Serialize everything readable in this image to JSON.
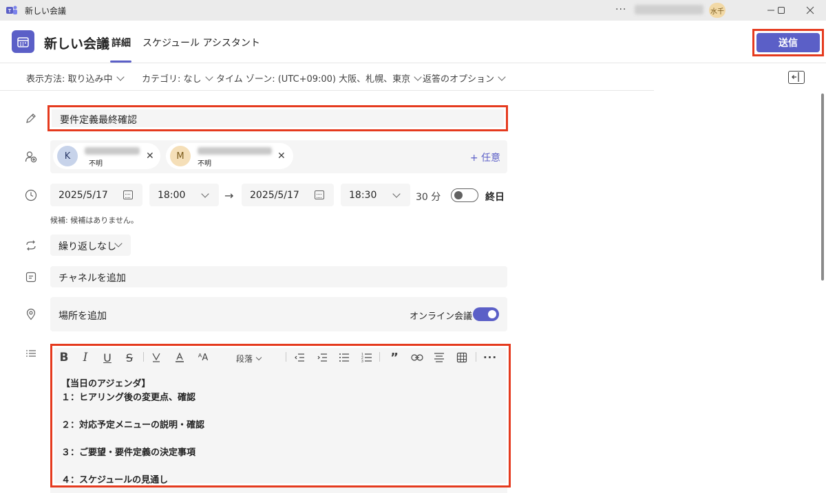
{
  "window": {
    "title": "新しい会議",
    "user_initials": "水千"
  },
  "header": {
    "title": "新しい会議",
    "tabs": [
      {
        "label": "詳細",
        "active": true
      },
      {
        "label": "スケジュール アシスタント",
        "active": false
      }
    ],
    "send_label": "送信"
  },
  "options": {
    "show_as": "表示方法: 取り込み中",
    "category": "カテゴリ: なし",
    "timezone": "タイム ゾーン: (UTC+09:00) 大阪、札幌、東京",
    "response": "返答のオプション"
  },
  "meeting": {
    "title_value": "要件定義最終確認",
    "attendees": [
      {
        "initial": "K",
        "status": "不明",
        "avatar_color": "#c7d3ea"
      },
      {
        "initial": "M",
        "status": "不明",
        "avatar_color": "#f5dfb8"
      }
    ],
    "optional_label": "+ 任意",
    "start_date": "2025/5/17",
    "start_time": "18:00",
    "end_date": "2025/5/17",
    "end_time": "18:30",
    "duration": "30 分",
    "all_day_label": "終日",
    "suggestion": "候補: 候補はありません。",
    "repeat": "繰り返しなし",
    "channel_placeholder": "チャネルを追加",
    "location_placeholder": "場所を追加",
    "online_label": "オンライン会議"
  },
  "editor": {
    "paragraph_label": "段落",
    "lines": [
      "【当日のアジェンダ】",
      "１：ヒアリング後の変更点、確認",
      "",
      "２：対応予定メニューの説明・確認",
      "",
      "３：ご要望・要件定義の決定事項",
      "",
      "４：スケジュールの見通し"
    ]
  },
  "colors": {
    "accent": "#5b5fc7",
    "highlight_frame": "#e53a1e"
  }
}
